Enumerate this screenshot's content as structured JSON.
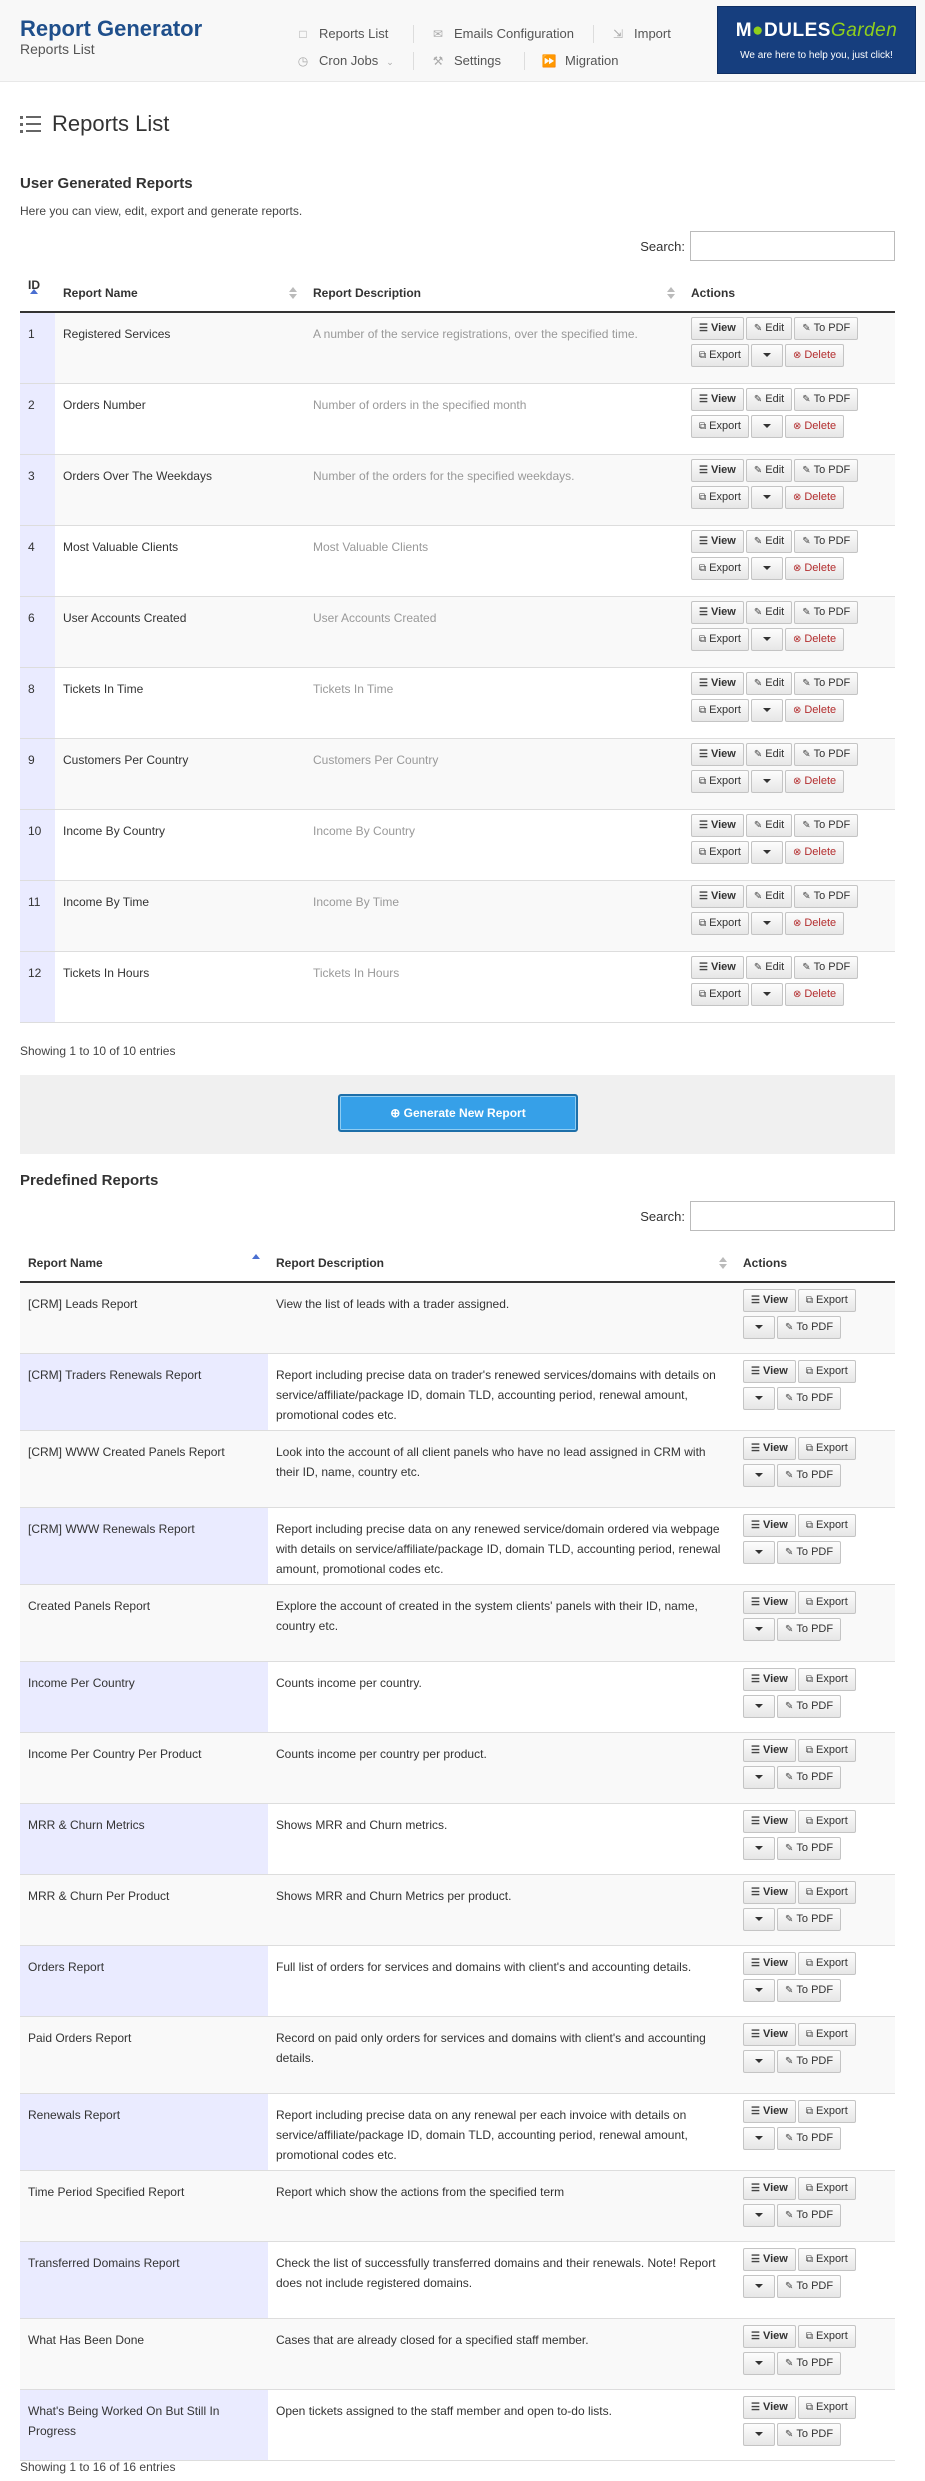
{
  "app": {
    "title": "Report Generator",
    "subtitle": "Reports List"
  },
  "nav": {
    "reports_list": "Reports List",
    "emails_configuration": "Emails Configuration",
    "import": "Import",
    "cron_jobs": "Cron Jobs",
    "settings": "Settings",
    "migration": "Migration"
  },
  "logo": {
    "name_a": "M",
    "name_b": "DULES",
    "name_c": "Garden",
    "tagline": "We are here to help you, just click!"
  },
  "page_title": "Reports List",
  "user_reports": {
    "heading": "User Generated Reports",
    "description": "Here you can view, edit, export and generate reports.",
    "search_label": "Search:",
    "search_value": "",
    "columns": [
      "ID",
      "Report Name",
      "Report Description",
      "Actions"
    ],
    "rows": [
      {
        "id": "1",
        "name": "Registered Services",
        "desc": "A number of the service registrations, over the specified time."
      },
      {
        "id": "2",
        "name": "Orders Number",
        "desc": "Number of orders in the specified month"
      },
      {
        "id": "3",
        "name": "Orders Over The Weekdays",
        "desc": "Number of the orders for the specified weekdays."
      },
      {
        "id": "4",
        "name": "Most Valuable Clients",
        "desc": "Most Valuable Clients"
      },
      {
        "id": "6",
        "name": "User Accounts Created",
        "desc": "User Accounts Created"
      },
      {
        "id": "8",
        "name": "Tickets In Time",
        "desc": "Tickets In Time"
      },
      {
        "id": "9",
        "name": "Customers Per Country",
        "desc": "Customers Per Country"
      },
      {
        "id": "10",
        "name": "Income By Country",
        "desc": "Income By Country"
      },
      {
        "id": "11",
        "name": "Income By Time",
        "desc": "Income By Time"
      },
      {
        "id": "12",
        "name": "Tickets In Hours",
        "desc": "Tickets In Hours"
      }
    ],
    "info": "Showing 1 to 10 of 10 entries"
  },
  "buttons": {
    "view": "View",
    "edit": "Edit",
    "to_pdf": "To PDF",
    "export": "Export",
    "delete": "Delete"
  },
  "generate_button": "Generate New Report",
  "predefined": {
    "heading": "Predefined Reports",
    "search_label": "Search:",
    "search_value": "",
    "columns": [
      "Report Name",
      "Report Description",
      "Actions"
    ],
    "rows": [
      {
        "name": "[CRM] Leads Report",
        "desc": "View the list of leads with a trader assigned."
      },
      {
        "name": "[CRM] Traders Renewals Report",
        "desc": "Report including precise data on trader's renewed services/domains with details on service/affiliate/package ID, domain TLD, accounting period, renewal amount, promotional codes etc."
      },
      {
        "name": "[CRM] WWW Created Panels Report",
        "desc": "Look into the account of all client panels who have no lead assigned in CRM with their ID, name, country etc."
      },
      {
        "name": "[CRM] WWW Renewals Report",
        "desc": "Report including precise data on any renewed service/domain ordered via webpage with details on service/affiliate/package ID, domain TLD, accounting period, renewal amount, promotional codes etc."
      },
      {
        "name": "Created Panels Report",
        "desc": "Explore the account of created in the system clients' panels with their ID, name, country etc."
      },
      {
        "name": "Income Per Country",
        "desc": "Counts income per country."
      },
      {
        "name": "Income Per Country Per Product",
        "desc": "Counts income per country per product."
      },
      {
        "name": "MRR & Churn Metrics",
        "desc": "Shows MRR and Churn metrics."
      },
      {
        "name": "MRR & Churn Per Product",
        "desc": "Shows MRR and Churn Metrics per product."
      },
      {
        "name": "Orders Report",
        "desc": "Full list of orders for services and domains with client's and accounting details."
      },
      {
        "name": "Paid Orders Report",
        "desc": "Record on paid only orders for services and domains with client's and accounting details."
      },
      {
        "name": "Renewals Report",
        "desc": "Report including precise data on any renewal per each invoice with details on service/affiliate/package ID, domain TLD, accounting period, renewal amount, promotional codes etc."
      },
      {
        "name": "Time Period Specified Report",
        "desc": "Report which show the actions from the specified term"
      },
      {
        "name": "Transferred Domains Report",
        "desc": "Check the list of successfully transferred domains and their renewals. Note! Report does not include registered domains."
      },
      {
        "name": "What Has Been Done",
        "desc": "Cases that are already closed for a specified staff member."
      },
      {
        "name": "What's Being Worked On But Still In Progress",
        "desc": "Open tickets assigned to the staff member and open to-do lists."
      }
    ],
    "info": "Showing 1 to 16 of 16 entries"
  }
}
